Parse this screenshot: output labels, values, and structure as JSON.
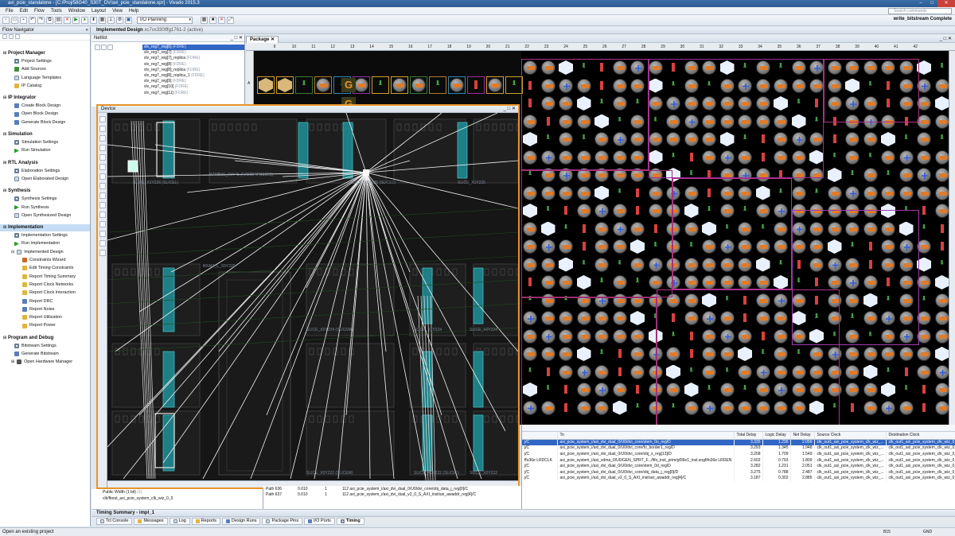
{
  "window": {
    "title": "axi_pcie_standalone - [C:/Proj/58G40_S30T_DV/axi_pcie_standalone.xpr] - Vivado 2015.3"
  },
  "menu": [
    "File",
    "Edit",
    "Flow",
    "Tools",
    "Window",
    "Layout",
    "View",
    "Help"
  ],
  "search": {
    "placeholder": "Search commands"
  },
  "toolbar": {
    "layout": "I/O Planning",
    "write_bitstream": "write_bitstream Complete"
  },
  "flow_navigator": {
    "title": "Flow Navigator",
    "sections": [
      {
        "name": "Project Manager",
        "items": [
          "Project Settings",
          "Add Sources",
          "Language Templates",
          "IP Catalog"
        ]
      },
      {
        "name": "IP Integrator",
        "items": [
          "Create Block Design",
          "Open Block Design",
          "Generate Block Design"
        ]
      },
      {
        "name": "Simulation",
        "items": [
          "Simulation Settings",
          "Run Simulation"
        ]
      },
      {
        "name": "RTL Analysis",
        "items": [
          "Elaboration Settings",
          "Open Elaborated Design"
        ]
      },
      {
        "name": "Synthesis",
        "items": [
          "Synthesis Settings",
          "Run Synthesis",
          "Open Synthesized Design"
        ]
      },
      {
        "name": "Implementation",
        "items": [
          "Implementation Settings",
          "Run Implementation",
          "Implemented Design"
        ],
        "sub": [
          "Constraints Wizard",
          "Edit Timing Constraints",
          "Report Timing Summary",
          "Report Clock Networks",
          "Report Clock Interaction",
          "Report DRC",
          "Report Noise",
          "Report Utilization",
          "Report Power"
        ]
      },
      {
        "name": "Program and Debug",
        "items": [
          "Bitstream Settings",
          "Generate Bitstream",
          "Open Hardware Manager"
        ]
      }
    ]
  },
  "design_header": {
    "title": "Implemented Design",
    "part": "xc7vx330tffg1761-2",
    "state": "(active)"
  },
  "netlist": {
    "title": "Netlist",
    "rows": [
      {
        "name": "slv_reg7_reg[6]",
        "type": "(FDRE)"
      },
      {
        "name": "slv_reg7_reg[7]",
        "type": "(FDRE)"
      },
      {
        "name": "slv_reg7_reg[7]_replica",
        "type": "(FDRE)"
      },
      {
        "name": "slv_reg7_reg[8]",
        "type": "(FDRE)"
      },
      {
        "name": "slv_reg7_reg[8]_replica",
        "type": "(FDRE)"
      },
      {
        "name": "slv_reg7_reg[8]_replica_1",
        "type": "(FDRE)"
      },
      {
        "name": "slv_reg7_reg[9]",
        "type": "(FDRE)"
      },
      {
        "name": "slv_reg7_reg[10]",
        "type": "(FDRE)"
      },
      {
        "name": "slv_reg7_reg[11]",
        "type": "(FDRE)"
      }
    ]
  },
  "package": {
    "tab": "Package",
    "columns": [
      "9",
      "10",
      "11",
      "12",
      "13",
      "14",
      "15",
      "16",
      "17",
      "18",
      "19",
      "20",
      "21",
      "22",
      "23",
      "24",
      "25",
      "26",
      "27",
      "28",
      "29",
      "30",
      "31",
      "32",
      "33",
      "34",
      "35",
      "36",
      "37",
      "38",
      "39",
      "40",
      "41",
      "42"
    ],
    "row_label": "A",
    "glyph": "G"
  },
  "device": {
    "title": "Device",
    "sites": [
      "SLICE_X1Y226 (SLICEL)",
      "RAMB36_X0Y45 (RAMBFIFO36E1)",
      "SLICE_X0Y226 (SLICEL)",
      "SLICE_X1Y225",
      "BRAM_L_X6Y220",
      "SLICE_X0Y224 (SLICEM)",
      "SLICE_X1Y224",
      "SLICE_X0Y224",
      "SLICE_X0Y222 (SLICEM)",
      "SLICE_X1Y222 (SLICEL)",
      "SLICE_X0Y222"
    ]
  },
  "bottom_left": {
    "rows": [
      {
        "name": "Public Width (1 bit)",
        "type": "(1)"
      },
      {
        "name": "clk/fbout_axi_pcie_system_clk_wiz_0_0",
        "type": ""
      }
    ]
  },
  "timing": {
    "title": "Timing Summary - impl_1",
    "columns": [
      "",
      "To",
      "Total Delay",
      "Logic Delay",
      "Net Delay",
      "Source Clock",
      "Destination Clock"
    ],
    "rows": [
      [
        "j/C",
        "axi_pcie_system_i/axi_dvi_dual_0/U0/dvi_core/stem_0o_reg/D",
        "3.335",
        "1.236",
        "2.099",
        "clk_out1_axi_pcie_system_clk_wiz_...",
        "clk_out1_axi_pcie_system_clk_wiz_0_0"
      ],
      [
        "j/C",
        "axi_pcie_system_i/axi_dvi_dual_0/U0/dvi_core/fo_border1_reg/D",
        "3.293",
        "1.345",
        "1.948",
        "clk_out1_axi_pcie_system_clk_wiz_...",
        "clk_out1_axi_pcie_system_clk_wiz_0_0"
      ],
      [
        "j/C",
        "axi_pcie_system_i/axi_dvi_dual_0/U0/dvi_core/obj_x_reg[13]/D",
        "3.258",
        "1.709",
        "1.549",
        "clk_out1_axi_pcie_system_clk_wiz_...",
        "clk_out1_axi_pcie_system_clk_wiz_0_0"
      ],
      [
        "ffo36e LRDCLK",
        "axi_pcie_system_i/axi_vdma_0/U0/GEN_SPRT_F.../fifo_inst_prim/gf36e1_inst.sngfifo36e LRDEN",
        "2.602",
        "0.793",
        "1.809",
        "clk_out1_axi_pcie_system_clk_wiz_...",
        "clk_out1_axi_pcie_system_clk_wiz_0_0"
      ],
      [
        "j/C",
        "axi_pcie_system_i/axi_dvi_dual_0/U0/dvi_core/stem_0d_reg/D",
        "3.282",
        "1.231",
        "2.051",
        "clk_out1_axi_pcie_system_clk_wiz_...",
        "clk_out1_axi_pcie_system_clk_wiz_0_0"
      ],
      [
        "j/C",
        "axi_pcie_system_i/axi_dvi_dual_0/U0/dvi_core/obj_data_j_reg[0]/D",
        "3.275",
        "0.788",
        "2.487",
        "clk_out1_axi_pcie_system_clk_wiz_...",
        "clk_out1_axi_pcie_system_clk_wiz_0_0"
      ],
      [
        "j/C",
        "axi_pcie_system_i/axi_dvi_dual_v2_0_S_AXI_inst/axi_awaddr_reg[4]/C",
        "3.187",
        "0.302",
        "2.885",
        "clk_out1_axi_pcie_system_clk_wiz_...",
        "clk_out1_axi_pcie_system_clk_wiz_0_0"
      ]
    ],
    "left_rows": [
      [
        "Path 636",
        "0.010",
        "1",
        "112 axi_pcie_system_i/axi_dvi_dual_0/U0/dvi_core/obj_data_j_reg[0]/C"
      ],
      [
        "Path 637",
        "0.010",
        "1",
        "112 axi_pcie_system_i/axi_dvi_dual_v2_0_S_AXI_inst/axi_awaddr_reg[4]/C"
      ]
    ]
  },
  "bottom_tabs": [
    "Tcl Console",
    "Messages",
    "Log",
    "Reports",
    "Design Runs",
    "Package Pins",
    "I/O Ports",
    "Timing"
  ],
  "status": {
    "left": "Open an existing project",
    "pin": "B15",
    "gnd": "GND"
  },
  "colors": {
    "accent": "#3166c4",
    "device_border": "#e8942a",
    "pad_orange": "#e07b2a",
    "io_blue": "#2f5be0"
  }
}
